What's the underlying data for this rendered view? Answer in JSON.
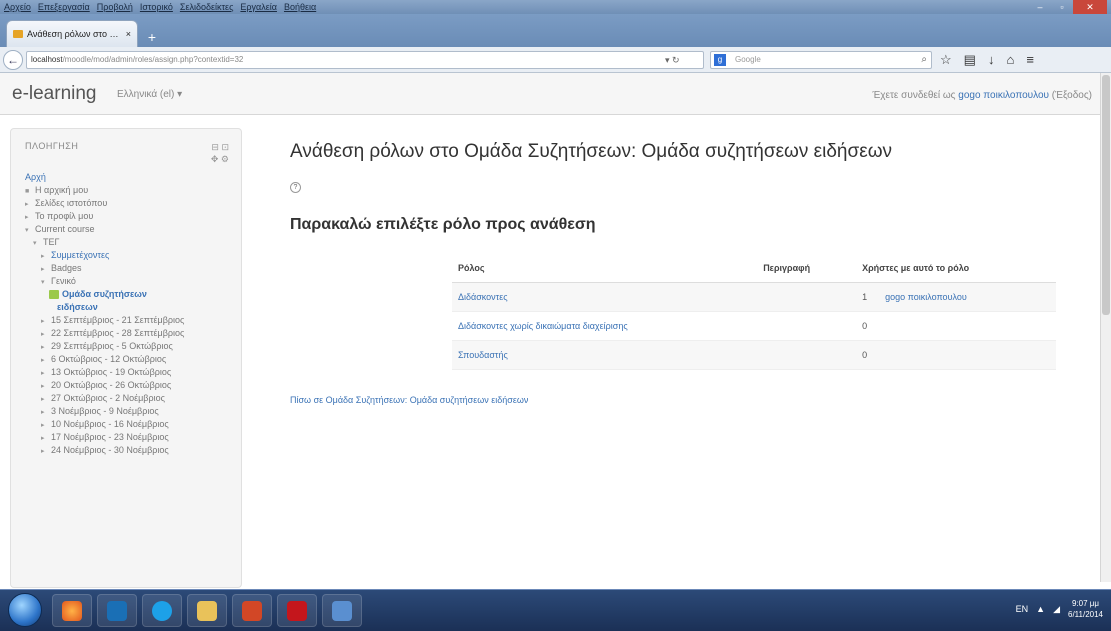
{
  "browser": {
    "menu": [
      "Αρχείο",
      "Επεξεργασία",
      "Προβολή",
      "Ιστορικό",
      "Σελιδοδείκτες",
      "Εργαλεία",
      "Βοήθεια"
    ],
    "tab_title": "Ανάθεση ρόλων στο Ομάδα...",
    "tab_close": "×",
    "new_tab": "+",
    "url_host": "localhost",
    "url_path": "/moodle/mod/admin/roles/assign.php?contextid=32",
    "search_engine": "Google",
    "search_placeholder": "Google"
  },
  "moodle": {
    "brand": "e-learning",
    "language": "Ελληνικά (el) ▾",
    "login_prefix": "Έχετε συνδεθεί ως ",
    "login_user": "gogo ποικιλοπουλου",
    "logout": " (Έξοδος)"
  },
  "navigation": {
    "title": "ΠΛΟΗΓΗΣΗ",
    "items": [
      {
        "label": "Αρχή",
        "level": 0,
        "type": "link",
        "arrow": ""
      },
      {
        "label": "Η αρχική μου",
        "level": 0,
        "type": "text",
        "arrow": "■"
      },
      {
        "label": "Σελίδες ιστοτόπου",
        "level": 0,
        "type": "text",
        "arrow": "▸"
      },
      {
        "label": "Το προφίλ μου",
        "level": 0,
        "type": "text",
        "arrow": "▸"
      },
      {
        "label": "Current course",
        "level": 0,
        "type": "text",
        "arrow": "▾"
      },
      {
        "label": "ΤΕΓ",
        "level": 1,
        "type": "text",
        "arrow": "▾"
      },
      {
        "label": "Συμμετέχοντες",
        "level": 2,
        "type": "link",
        "arrow": "▸"
      },
      {
        "label": "Badges",
        "level": 2,
        "type": "text",
        "arrow": "▸"
      },
      {
        "label": "Γενικό",
        "level": 2,
        "type": "text",
        "arrow": "▾"
      },
      {
        "label": "Ομάδα συζητήσεων",
        "level": 3,
        "type": "active",
        "arrow": ""
      },
      {
        "label": "ειδήσεων",
        "level": 4,
        "type": "active",
        "arrow": ""
      },
      {
        "label": "15 Σεπτέμβριος - 21 Σεπτέμβριος",
        "level": 2,
        "type": "text",
        "arrow": "▸"
      },
      {
        "label": "22 Σεπτέμβριος - 28 Σεπτέμβριος",
        "level": 2,
        "type": "text",
        "arrow": "▸"
      },
      {
        "label": "29 Σεπτέμβριος - 5 Οκτώβριος",
        "level": 2,
        "type": "text",
        "arrow": "▸"
      },
      {
        "label": "6 Οκτώβριος - 12 Οκτώβριος",
        "level": 2,
        "type": "text",
        "arrow": "▸"
      },
      {
        "label": "13 Οκτώβριος - 19 Οκτώβριος",
        "level": 2,
        "type": "text",
        "arrow": "▸"
      },
      {
        "label": "20 Οκτώβριος - 26 Οκτώβριος",
        "level": 2,
        "type": "text",
        "arrow": "▸"
      },
      {
        "label": "27 Οκτώβριος - 2 Νοέμβριος",
        "level": 2,
        "type": "text",
        "arrow": "▸"
      },
      {
        "label": "3 Νοέμβριος - 9 Νοέμβριος",
        "level": 2,
        "type": "text",
        "arrow": "▸"
      },
      {
        "label": "10 Νοέμβριος - 16 Νοέμβριος",
        "level": 2,
        "type": "text",
        "arrow": "▸"
      },
      {
        "label": "17 Νοέμβριος - 23 Νοέμβριος",
        "level": 2,
        "type": "text",
        "arrow": "▸"
      },
      {
        "label": "24 Νοέμβριος - 30 Νοέμβριος",
        "level": 2,
        "type": "text",
        "arrow": "▸"
      }
    ]
  },
  "main": {
    "title": "Ανάθεση ρόλων στο Ομάδα Συζητήσεων: Ομάδα συζητήσεων ειδήσεων",
    "subtitle": "Παρακαλώ επιλέξτε ρόλο προς ανάθεση",
    "table": {
      "headers": [
        "Ρόλος",
        "Περιγραφή",
        "Χρήστες με αυτό το ρόλο"
      ],
      "rows": [
        {
          "role": "Διδάσκοντες",
          "description": "",
          "count": "1",
          "users": "gogo ποικιλοπουλου"
        },
        {
          "role": "Διδάσκοντες χωρίς δικαιώματα διαχείρισης",
          "description": "",
          "count": "0",
          "users": ""
        },
        {
          "role": "Σπουδαστής",
          "description": "",
          "count": "0",
          "users": ""
        }
      ]
    },
    "back_link": "Πίσω σε Ομάδα Συζητήσεων: Ομάδα συζητήσεων ειδήσεων"
  },
  "taskbar": {
    "language": "EN",
    "time": "9:07 μμ",
    "date": "6/11/2014"
  }
}
